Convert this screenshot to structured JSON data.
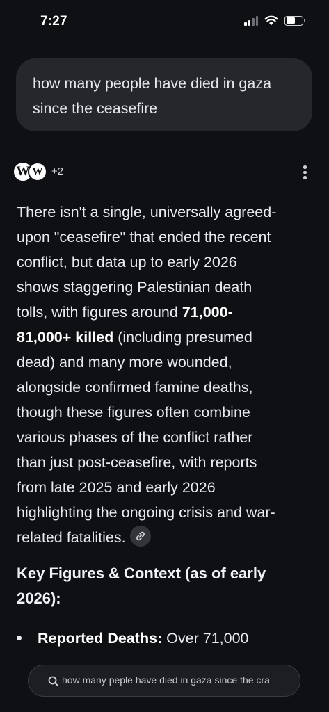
{
  "status_bar": {
    "time": "7:27",
    "signal_bars": 2,
    "battery_level_fraction": 0.5
  },
  "query": {
    "text": "how many people have died in gaza since the ceasefire"
  },
  "sources": {
    "icons": [
      "wikipedia-icon",
      "wikipedia-icon"
    ],
    "extra_count": "+2"
  },
  "answer": {
    "line_1": "There isn't a single, universally agreed-",
    "line_2": "upon \"ceasefire\" that ended the recent",
    "line_3": "conflict, but data up to early 2026",
    "line_4": "shows staggering Palestinian death",
    "line_5_pre": "tolls, with figures around ",
    "line_5_bold": "71,000-",
    "line_6_bold": "81,000+ killed",
    "line_6_post": " (including presumed",
    "line_7": "dead) and many more wounded,",
    "line_8": "alongside confirmed famine deaths,",
    "line_9": "though these figures often combine",
    "line_10": "various phases of the conflict rather",
    "line_11": "than just post-ceasefire, with reports",
    "line_12": "from late 2025 and early 2026",
    "line_13": "highlighting the ongoing crisis and war-",
    "line_14": "related fatalities.",
    "link_icon": "link-icon"
  },
  "key_figures": {
    "heading_line_1": "Key Figures & Context (as of early",
    "heading_line_2": "2026):",
    "bullet_1_label": "Reported Deaths:",
    "bullet_1_text": " Over 71,000"
  },
  "search_bar": {
    "text": "how many peple have died in gaza since the cra",
    "icon": "search-icon"
  },
  "colors": {
    "background": "#0f1014",
    "bubble": "#26272c",
    "text": "#e9eaee",
    "pill": "#1d1e22"
  }
}
